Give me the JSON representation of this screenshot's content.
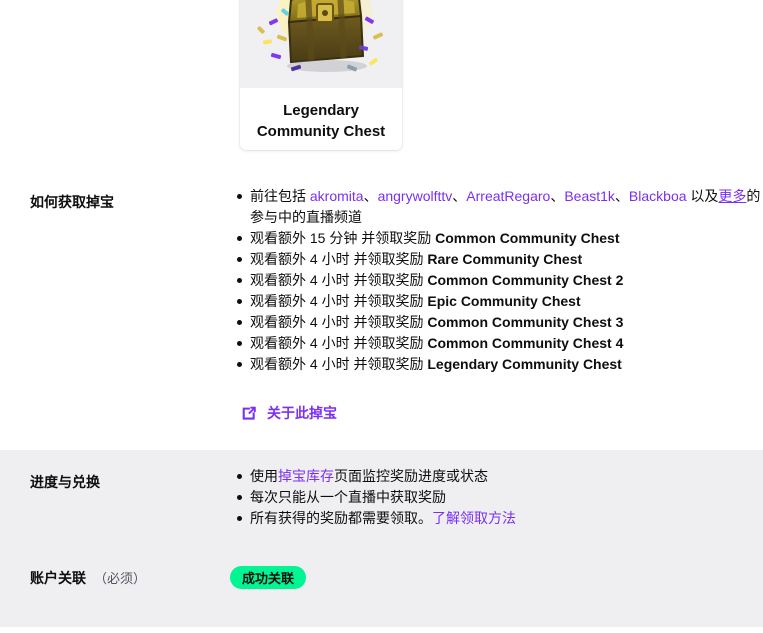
{
  "chest_card": {
    "name": "Legendary\nCommunity Chest",
    "name_line1": "Legendary",
    "name_line2": "Community Chest",
    "image_icon": "treasure-chest-image"
  },
  "sections": {
    "how_to_earn": {
      "label": "如何获取掉宝",
      "bullets": [
        {
          "prefix": "前往包括 ",
          "channels": [
            "akromita",
            "angrywolfttv",
            "ArreatRegaro",
            "Beast1k",
            "Blackboa"
          ],
          "separator": "、",
          "middle": " 以及",
          "more_link": "更多",
          "suffix": "的参与中的直播频道"
        },
        {
          "text": "观看额外 15 分钟 并领取奖励 ",
          "reward": "Common Community Chest"
        },
        {
          "text": "观看额外 4 小时 并领取奖励 ",
          "reward": "Rare Community Chest"
        },
        {
          "text": "观看额外 4 小时 并领取奖励 ",
          "reward": "Common Community Chest 2"
        },
        {
          "text": "观看额外 4 小时 并领取奖励 ",
          "reward": "Epic Community Chest"
        },
        {
          "text": "观看额外 4 小时 并领取奖励 ",
          "reward": "Common Community Chest 3"
        },
        {
          "text": "观看额外 4 小时 并领取奖励 ",
          "reward": "Common Community Chest 4"
        },
        {
          "text": "观看额外 4 小时 并领取奖励 ",
          "reward": "Legendary Community Chest"
        }
      ],
      "about_link": {
        "label": "关于此掉宝",
        "icon": "external-link-icon"
      }
    },
    "progress": {
      "label": "进度与兑换",
      "bullets": [
        {
          "pre": "使用",
          "link": "掉宝库存",
          "post": "页面监控奖励进度或状态"
        },
        {
          "pre": "每次只能从一个直播中获取奖励",
          "link": "",
          "post": ""
        },
        {
          "pre": "所有获得的奖励都需要领取。",
          "link": "了解领取方法",
          "post": ""
        }
      ]
    },
    "account_link": {
      "label": "账户关联",
      "optional_note": "（必须）",
      "status_badge": "成功关联"
    }
  },
  "colors": {
    "link_purple": "#7b2ff2",
    "badge_green": "#00f593",
    "band_gray": "#efeff1",
    "text": "#0e0e10"
  }
}
